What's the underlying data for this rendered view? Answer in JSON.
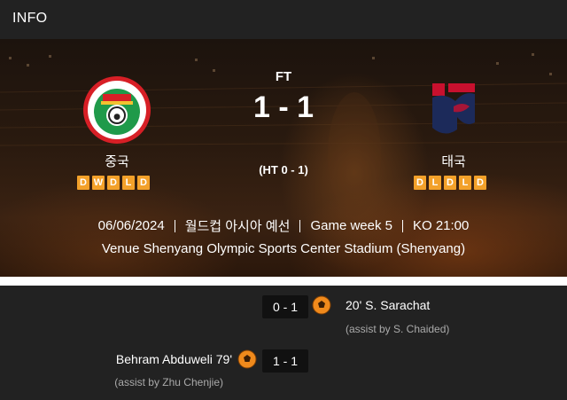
{
  "header": {
    "title": "INFO"
  },
  "match": {
    "status": "FT",
    "score": "1 - 1",
    "halftime": "(HT 0 - 1)",
    "date": "06/06/2024",
    "competition": "월드컵 아시아 예선",
    "game_week": "Game week 5",
    "kickoff": "KO 21:00",
    "venue": "Venue Shenyang Olympic Sports Center Stadium (Shenyang)"
  },
  "home": {
    "name": "중국",
    "crest": "china-football-association-crest",
    "form": [
      "D",
      "W",
      "D",
      "L",
      "D"
    ]
  },
  "away": {
    "name": "태국",
    "crest": "thailand-football-association-crest",
    "form": [
      "D",
      "L",
      "D",
      "L",
      "D"
    ]
  },
  "events": [
    {
      "side": "away",
      "score": "0 - 1",
      "scorer": "20' S. Sarachat",
      "assist": "(assist by S. Chaided)",
      "icon": "soccer-ball-icon"
    },
    {
      "side": "home",
      "score": "1 - 1",
      "scorer": "Behram Abduweli 79'",
      "assist": "(assist by Zhu Chenjie)",
      "icon": "soccer-ball-icon"
    }
  ],
  "colors": {
    "form_badge": "#f3a12a",
    "panel": "#222222",
    "accent": "#f08a1c"
  }
}
